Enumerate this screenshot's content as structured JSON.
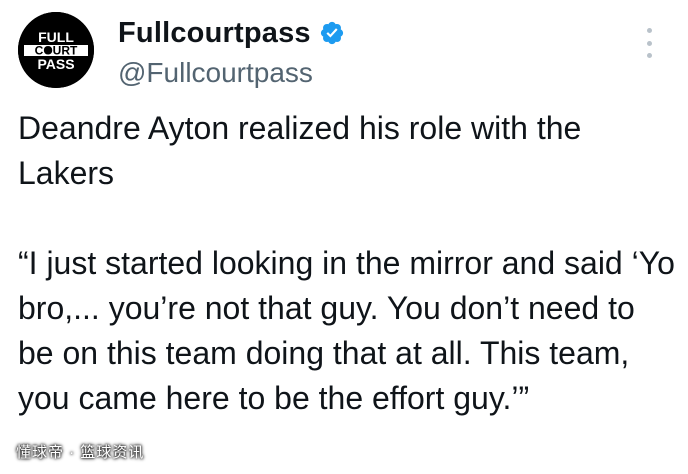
{
  "account": {
    "display_name": "Fullcourtpass",
    "handle": "@Fullcourtpass",
    "avatar_text": [
      "FULL",
      "COURT",
      "PASS"
    ],
    "verified": true,
    "verified_color": "#1d9bf0"
  },
  "tweet": {
    "line1": "Deandre Ayton realized his role with the Lakers",
    "quote": "“I just started looking in the mirror and said ‘Yo bro,... you’re not that guy. You don’t need to be on this team doing that at all. This team, you came here to be the effort guy.’”"
  },
  "icons": {
    "more": "more-options-icon",
    "verified": "verified-badge-icon"
  },
  "watermark": "懂球帝 · 篮球资讯"
}
